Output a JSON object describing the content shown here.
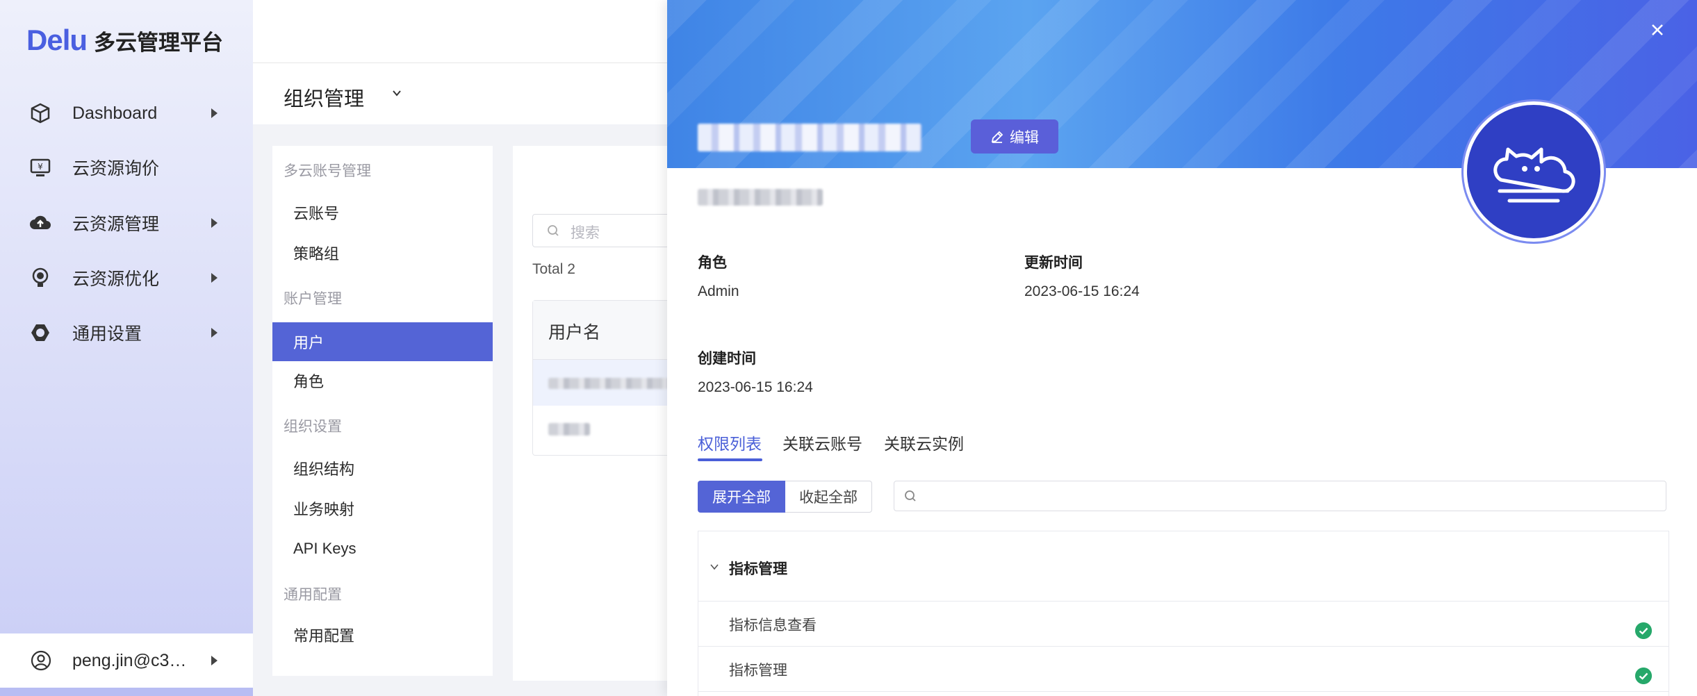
{
  "app": {
    "brand": "Delu",
    "title": "多云管理平台"
  },
  "sidebar": {
    "items": [
      {
        "label": "Dashboard",
        "icon": "cube-icon",
        "has_children": true
      },
      {
        "label": "云资源询价",
        "icon": "monitor-price-icon",
        "has_children": false
      },
      {
        "label": "云资源管理",
        "icon": "cloud-upload-icon",
        "has_children": true
      },
      {
        "label": "云资源优化",
        "icon": "bulb-icon",
        "has_children": true
      },
      {
        "label": "通用设置",
        "icon": "settings-hex-icon",
        "has_children": true
      }
    ],
    "user": {
      "name": "peng.jin@c3…",
      "icon": "user-circle-icon"
    }
  },
  "header": {
    "title": "组织管理"
  },
  "submenu": {
    "groups": [
      {
        "title": "多云账号管理",
        "items": [
          "云账号",
          "策略组"
        ]
      },
      {
        "title": "账户管理",
        "items": [
          "用户",
          "角色"
        ]
      },
      {
        "title": "组织设置",
        "items": [
          "组织结构",
          "业务映射",
          "API Keys"
        ]
      },
      {
        "title": "通用配置",
        "items": [
          "常用配置"
        ]
      }
    ],
    "active": "用户"
  },
  "list": {
    "search_placeholder": "搜索",
    "total": "Total 2",
    "columns": [
      "用户名"
    ]
  },
  "drawer": {
    "edit_label": "编辑",
    "fields": {
      "role_label": "角色",
      "role_value": "Admin",
      "updated_label": "更新时间",
      "updated_value": "2023-06-15 16:24",
      "created_label": "创建时间",
      "created_value": "2023-06-15 16:24"
    },
    "tabs": [
      "权限列表",
      "关联云账号",
      "关联云实例"
    ],
    "active_tab": "权限列表",
    "expand_all": "展开全部",
    "collapse_all": "收起全部",
    "permissions": {
      "group": "指标管理",
      "rows": [
        "指标信息查看",
        "指标管理"
      ]
    },
    "colors": {
      "accent": "#5464d6",
      "check": "#26a86a"
    }
  }
}
